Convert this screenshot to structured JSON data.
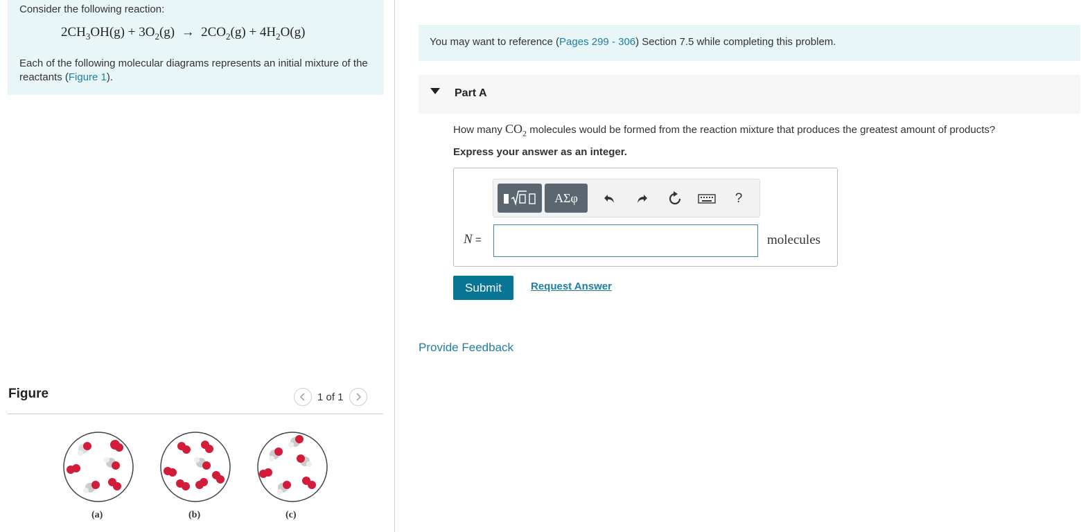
{
  "intro": {
    "consider_text": "Consider the following reaction:",
    "desc_text": "Each of the following molecular diagrams represents an initial mixture of the reactants (",
    "figure_link": "Figure 1",
    "desc_end": ")."
  },
  "figure": {
    "title": "Figure",
    "page_indicator": "1 of 1",
    "labels": [
      "(a)",
      "(b)",
      "(c)"
    ]
  },
  "reference": {
    "pre": "You may want to reference (",
    "link": "Pages 299 - 306",
    "post": ") Section 7.5 while completing this problem."
  },
  "part": {
    "title": "Part A",
    "question_pre": "How many ",
    "question_post": " molecules would be formed from the reaction mixture that produces the greatest amount of products?",
    "instruction": "Express your answer as an integer.",
    "toolbar": {
      "greek_label": "ΑΣφ",
      "help_label": "?"
    },
    "var_label": "N",
    "equals": " =",
    "input_value": "",
    "units": "molecules",
    "submit_label": "Submit",
    "request_label": "Request Answer"
  },
  "feedback_label": "Provide Feedback",
  "colors": {
    "accent": "#087594",
    "link": "#1f7ea3",
    "panel_bg": "#e9f6f8"
  }
}
